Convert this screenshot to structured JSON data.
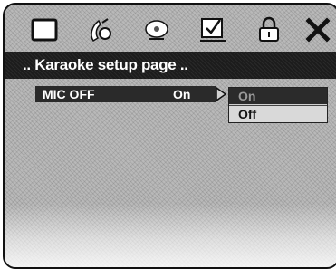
{
  "toolbar": {
    "icons": [
      "general-setup-icon",
      "audio-setup-icon",
      "video-setup-icon",
      "preference-icon",
      "password-lock-icon",
      "exit-icon"
    ]
  },
  "title": ".. Karaoke setup page ..",
  "setting": {
    "label": "MIC OFF",
    "value": "On"
  },
  "dropdown": {
    "options": [
      "On",
      "Off"
    ],
    "selected": "On"
  }
}
